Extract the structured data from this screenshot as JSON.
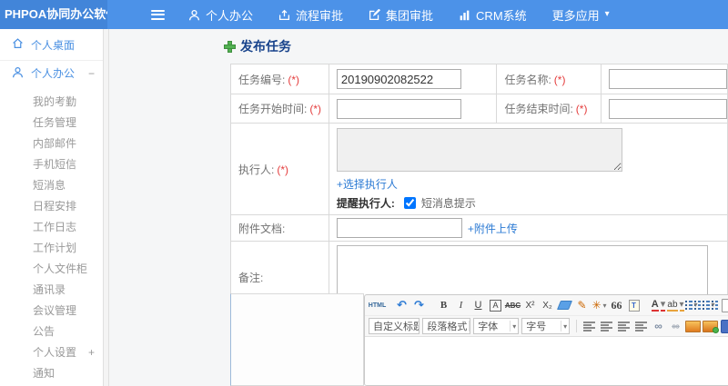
{
  "ui": {
    "caret": "▾"
  },
  "topbar": {
    "logo": "PHPOA协同办公软件",
    "nav": [
      {
        "label": "个人办公",
        "icon": "user-icon"
      },
      {
        "label": "流程审批",
        "icon": "workflow-approve-icon"
      },
      {
        "label": "集团审批",
        "icon": "group-approve-icon"
      },
      {
        "label": "CRM系统",
        "icon": "crm-chart-icon"
      },
      {
        "label": "更多应用",
        "icon": "caret-down-icon"
      }
    ]
  },
  "sidebar": {
    "desktop": "个人桌面",
    "group": "个人办公",
    "group_collapse": "−",
    "items": [
      "我的考勤",
      "任务管理",
      "内部邮件",
      "手机短信",
      "短消息",
      "日程安排",
      "工作日志",
      "工作计划",
      "个人文件柜",
      "通讯录",
      "会议管理",
      "公告"
    ],
    "settings": "个人设置",
    "settings_expand": "+",
    "notice": "通知"
  },
  "form": {
    "title": "发布任务",
    "required": "(*)",
    "task_no_label": "任务编号:",
    "task_no_value": "20190902082522",
    "task_name_label": "任务名称:",
    "start_label": "任务开始时间:",
    "end_label": "任务结束时间:",
    "executor_label": "执行人:",
    "select_executor_link": "+选择执行人",
    "remind_label": "提醒执行人:",
    "remind_option": "短消息提示",
    "attach_label": "附件文档:",
    "attach_link": "+附件上传",
    "remark_label": "备注:"
  },
  "editor": {
    "row1": [
      {
        "name": "source-html-button",
        "glyph": "HTML",
        "type": "html"
      },
      {
        "type": "sep"
      },
      {
        "name": "undo-button",
        "glyph": "↶",
        "type": "blue"
      },
      {
        "name": "redo-button",
        "glyph": "↷",
        "type": "blue"
      },
      {
        "type": "sep"
      },
      {
        "name": "bold-button",
        "glyph": "B",
        "type": "bold"
      },
      {
        "name": "italic-button",
        "glyph": "I",
        "type": "italic"
      },
      {
        "name": "underline-button",
        "glyph": "U",
        "type": "underline"
      },
      {
        "name": "font-border-button",
        "glyph": "A",
        "type": "boxed"
      },
      {
        "name": "strikethrough-button",
        "glyph": "ABC",
        "type": "strike"
      },
      {
        "name": "superscript-button",
        "glyph": "X²",
        "type": "plain"
      },
      {
        "name": "subscript-button",
        "glyph": "X₂",
        "type": "plain"
      },
      {
        "name": "remove-format-eraser-button",
        "glyph": "",
        "type": "eraser"
      },
      {
        "name": "format-painter-button",
        "glyph": "✎",
        "type": "orange"
      },
      {
        "name": "auto-typeset-button",
        "glyph": "✳",
        "type": "orange",
        "caret": true
      },
      {
        "name": "blockquote-button",
        "glyph": "66",
        "type": "quote"
      },
      {
        "name": "paste-plain-button",
        "glyph": "T",
        "type": "paste"
      },
      {
        "type": "sep"
      },
      {
        "name": "font-color-button",
        "glyph": "A",
        "type": "fontcolor",
        "caret": true
      },
      {
        "name": "highlight-color-button",
        "glyph": "ab",
        "type": "highlight",
        "caret": true
      },
      {
        "name": "ordered-list-button",
        "glyph": "",
        "type": "list",
        "caret": true
      },
      {
        "name": "unordered-list-button",
        "glyph": "",
        "type": "list",
        "caret": true
      },
      {
        "name": "new-document-button",
        "glyph": "",
        "type": "doc"
      }
    ],
    "row2_selects": [
      {
        "name": "custom-style-select",
        "label": "自定义标题"
      },
      {
        "name": "paragraph-format-select",
        "label": "段落格式"
      },
      {
        "name": "font-family-select",
        "label": "字体"
      },
      {
        "name": "font-size-select",
        "label": "字号"
      }
    ],
    "row2_buttons": [
      {
        "name": "justify-left-button",
        "glyph": "",
        "type": "align"
      },
      {
        "name": "justify-center-button",
        "glyph": "",
        "type": "align"
      },
      {
        "name": "justify-right-button",
        "glyph": "",
        "type": "align"
      },
      {
        "name": "justify-full-button",
        "glyph": "",
        "type": "align"
      },
      {
        "name": "insert-link-button",
        "glyph": "∞",
        "type": "link"
      },
      {
        "name": "unlink-button",
        "glyph": "∞",
        "type": "unlink"
      },
      {
        "name": "insert-image-button",
        "glyph": "",
        "type": "image"
      },
      {
        "name": "image-manager-button",
        "glyph": "",
        "type": "image2"
      },
      {
        "name": "attachment-button",
        "glyph": "",
        "type": "bluebox"
      }
    ]
  }
}
